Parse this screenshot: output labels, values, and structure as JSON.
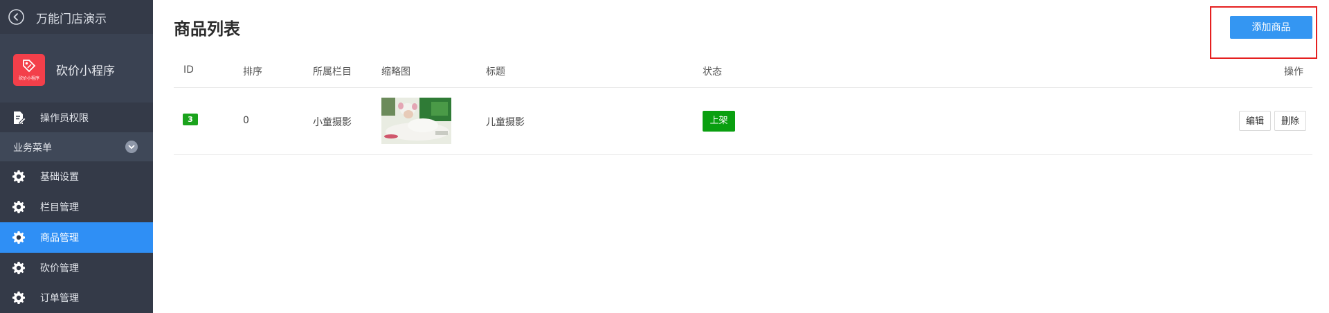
{
  "sidebar": {
    "store_name": "万能门店演示",
    "app_name": "砍价小程序",
    "app_logo_text": "砍价小程序",
    "permissions_label": "操作员权限",
    "section_label": "业务菜单",
    "items": [
      {
        "label": "基础设置",
        "icon": "gear-icon"
      },
      {
        "label": "栏目管理",
        "icon": "gear-icon"
      },
      {
        "label": "商品管理",
        "icon": "gear-icon",
        "active": true
      },
      {
        "label": "砍价管理",
        "icon": "gear-icon"
      },
      {
        "label": "订单管理",
        "icon": "gear-icon"
      }
    ]
  },
  "main": {
    "title": "商品列表",
    "add_button": "添加商品",
    "columns": [
      "ID",
      "排序",
      "所属栏目",
      "缩略图",
      "标题",
      "状态",
      "操作"
    ],
    "rows": [
      {
        "id": "3",
        "sort": "0",
        "category": "小童摄影",
        "title": "儿童摄影",
        "status": "上架",
        "actions": [
          "编辑",
          "删除"
        ]
      }
    ]
  },
  "colors": {
    "sidebar_bg": "#343a48",
    "active_bg": "#2f8ff5",
    "primary": "#3496f2",
    "success": "#0a9f10",
    "highlight_border": "#e52020"
  }
}
